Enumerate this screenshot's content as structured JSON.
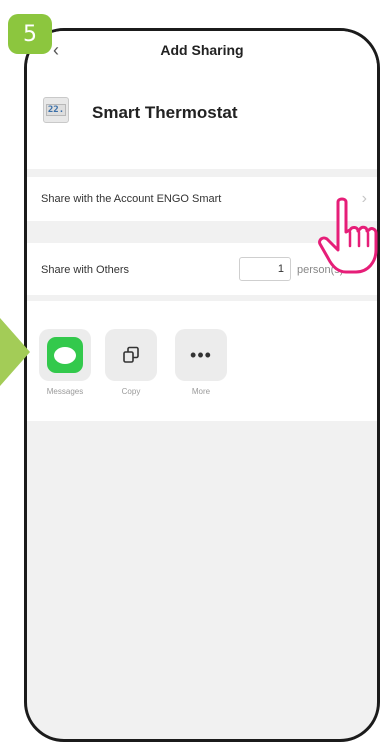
{
  "step": {
    "number": "5"
  },
  "header": {
    "title": "Add Sharing",
    "back_icon": "chevron-left-icon"
  },
  "device": {
    "icon_text": "22.",
    "name": "Smart Thermostat"
  },
  "share_account": {
    "label": "Share with the Account ENGO Smart",
    "icon": "chevron-right-icon"
  },
  "share_others": {
    "label": "Share with Others",
    "count": "1",
    "unit": "person(s)"
  },
  "share_options": [
    {
      "label": "Messages",
      "icon": "messages-icon",
      "color": "#33c94c"
    },
    {
      "label": "Copy",
      "icon": "copy-icon"
    },
    {
      "label": "More",
      "icon": "more-icon"
    }
  ],
  "colors": {
    "badge": "#8cc63e",
    "hand": "#e61e78",
    "background": "#f1f1f1"
  }
}
